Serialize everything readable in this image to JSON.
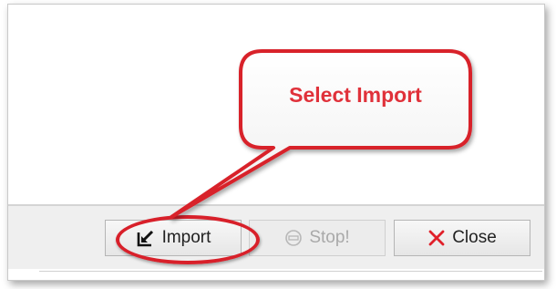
{
  "buttons": {
    "import_label": "Import",
    "stop_label": "Stop!",
    "close_label": "Close"
  },
  "annotation": {
    "callout_text": "Select Import"
  },
  "icons": {
    "import": "import-arrow-icon",
    "stop": "stop-icon",
    "close": "close-x-icon"
  },
  "colors": {
    "annotation_red": "#d8202a",
    "callout_text": "#e0313a",
    "close_x": "#e0202a"
  }
}
